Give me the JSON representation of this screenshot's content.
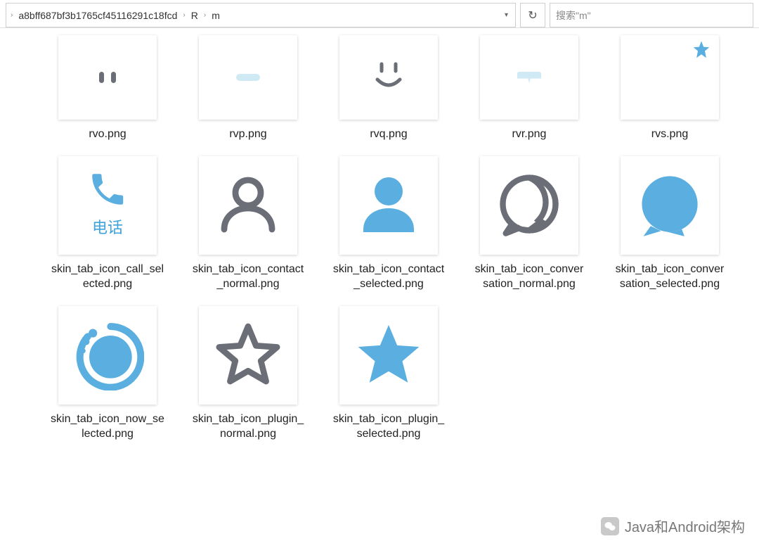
{
  "colors": {
    "accent": "#5aaee0",
    "muted": "#6b6e76",
    "light": "#cfeaf5"
  },
  "toolbar": {
    "crumbs": [
      "a8bff687bf3b1765cf45116291c18fcd",
      "R",
      "m"
    ],
    "search_placeholder": "搜索\"m\""
  },
  "files": [
    {
      "name": "rvo.png",
      "icon": "rvo-icon"
    },
    {
      "name": "rvp.png",
      "icon": "rvp-icon"
    },
    {
      "name": "rvq.png",
      "icon": "rvq-icon"
    },
    {
      "name": "rvr.png",
      "icon": "rvr-icon"
    },
    {
      "name": "rvs.png",
      "icon": "rvs-icon"
    },
    {
      "name": "skin_tab_icon_call_selected.png",
      "icon": "call-selected-icon",
      "label": "电话"
    },
    {
      "name": "skin_tab_icon_contact_normal.png",
      "icon": "contact-normal-icon"
    },
    {
      "name": "skin_tab_icon_contact_selected.png",
      "icon": "contact-selected-icon"
    },
    {
      "name": "skin_tab_icon_conversation_normal.png",
      "icon": "conversation-normal-icon"
    },
    {
      "name": "skin_tab_icon_conversation_selected.png",
      "icon": "conversation-selected-icon"
    },
    {
      "name": "skin_tab_icon_now_selected.png",
      "icon": "now-selected-icon"
    },
    {
      "name": "skin_tab_icon_plugin_normal.png",
      "icon": "plugin-normal-icon"
    },
    {
      "name": "skin_tab_icon_plugin_selected.png",
      "icon": "plugin-selected-icon"
    }
  ],
  "watermark": {
    "text": "Java和Android架构"
  }
}
